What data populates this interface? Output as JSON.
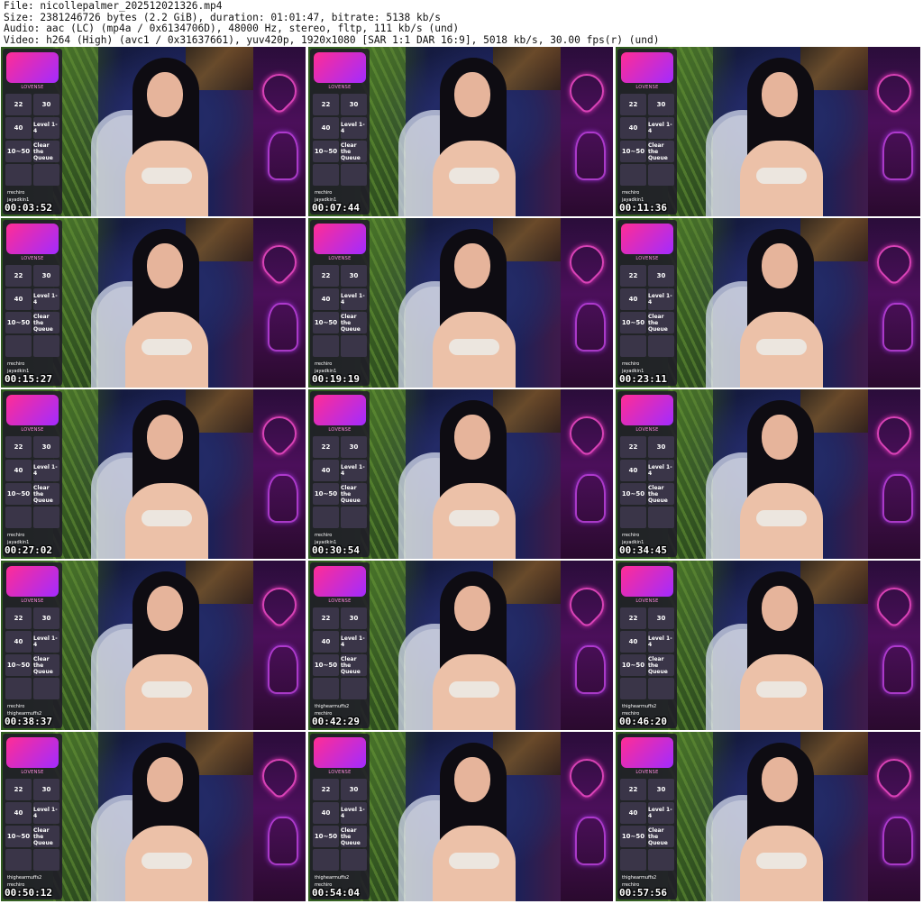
{
  "header": {
    "line1": "File: nicollepalmer_202512021326.mp4",
    "line2": "Size: 2381246726 bytes (2.2 GiB), duration: 01:01:47, bitrate: 5138 kb/s",
    "line3": "Audio: aac (LC) (mp4a / 0x6134706D), 48000 Hz, stereo, fltp, 111 kb/s (und)",
    "line4": "Video: h264 (High) (avc1 / 0x31637661), yuv420p, 1920x1080 [SAR 1:1 DAR 16:9], 5018 kb/s, 30.00 fps(r) (und)"
  },
  "thumbnails": [
    {
      "time": "00:03:52",
      "top": "rrechiro",
      "second": "jayadkin1"
    },
    {
      "time": "00:07:44",
      "top": "rrechiro",
      "second": "jayadkin1"
    },
    {
      "time": "00:11:36",
      "top": "rrechiro",
      "second": "jayadkin1"
    },
    {
      "time": "00:15:27",
      "top": "rrechiro",
      "second": "jayadkin1"
    },
    {
      "time": "00:19:19",
      "top": "rrechiro",
      "second": "jayadkin1"
    },
    {
      "time": "00:23:11",
      "top": "rrechiro",
      "second": "jayadkin1"
    },
    {
      "time": "00:27:02",
      "top": "rrechiro",
      "second": "jayadkin1"
    },
    {
      "time": "00:30:54",
      "top": "rrechiro",
      "second": "jayadkin1"
    },
    {
      "time": "00:34:45",
      "top": "rrechiro",
      "second": "jayadkin1"
    },
    {
      "time": "00:38:37",
      "top": "rrechiro",
      "second": "thighearmuffs2"
    },
    {
      "time": "00:42:29",
      "top": "thighearmuffs2",
      "second": "rrechiro"
    },
    {
      "time": "00:46:20",
      "top": "thighearmuffs2",
      "second": "rrechiro"
    },
    {
      "time": "00:50:12",
      "top": "thighearmuffs2",
      "second": "rrechiro"
    },
    {
      "time": "00:54:04",
      "top": "thighearmuffs2",
      "second": "rrechiro"
    },
    {
      "time": "00:57:56",
      "top": "thighearmuffs2",
      "second": "rrechiro"
    }
  ],
  "overlay": {
    "brand": "LOVENSE",
    "cells": [
      "22",
      "30",
      "40",
      "Level 1-4",
      "10~50",
      "Clear the Queue",
      "",
      ""
    ]
  }
}
